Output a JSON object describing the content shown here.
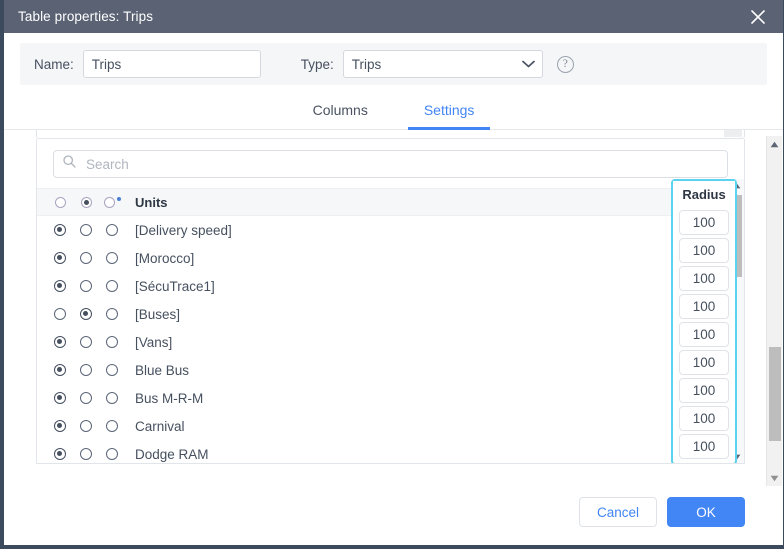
{
  "window": {
    "title": "Table properties: Trips",
    "close_icon": "close-icon"
  },
  "form": {
    "name_label": "Name:",
    "name_value": "Trips",
    "type_label": "Type:",
    "type_value": "Trips",
    "help_glyph": "?"
  },
  "tabs": [
    {
      "label": "Columns",
      "active": false
    },
    {
      "label": "Settings",
      "active": true
    }
  ],
  "search": {
    "placeholder": "Search",
    "value": "",
    "icon": "search-icon"
  },
  "table": {
    "header": {
      "radio_states": [
        "off",
        "on",
        "off"
      ],
      "units_label": "Units",
      "radius_label": "Radius"
    },
    "rows": [
      {
        "label": "[Delivery speed]",
        "selected": 0,
        "radius": "100"
      },
      {
        "label": "[Morocco]",
        "selected": 0,
        "radius": "100"
      },
      {
        "label": "[SécuTrace1]",
        "selected": 0,
        "radius": "100"
      },
      {
        "label": "[Buses]",
        "selected": 1,
        "radius": "100"
      },
      {
        "label": "[Vans]",
        "selected": 0,
        "radius": "100"
      },
      {
        "label": "Blue Bus",
        "selected": 0,
        "radius": "100"
      },
      {
        "label": "Bus M-R-M",
        "selected": 0,
        "radius": "100"
      },
      {
        "label": "Carnival",
        "selected": 0,
        "radius": "100"
      },
      {
        "label": "Dodge RAM",
        "selected": 0,
        "radius": "100"
      }
    ]
  },
  "footer": {
    "cancel_label": "Cancel",
    "ok_label": "OK"
  },
  "colors": {
    "titlebar": "#5a6273",
    "accent": "#4285f4",
    "highlight": "#5bd3f0",
    "text": "#46505f",
    "border": "#3c4a5e"
  }
}
